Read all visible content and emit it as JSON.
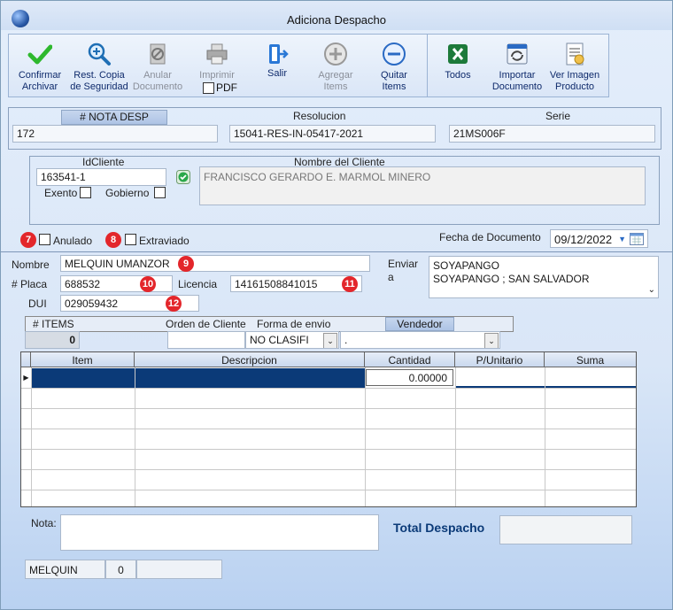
{
  "window": {
    "title": "Adiciona Despacho"
  },
  "toolbar": {
    "confirm": "Confirmar\nArchivar",
    "restore": "Rest. Copia\nde Seguridad",
    "anular": "Anular\nDocumento",
    "imprimir": "Imprimir",
    "pdf": "PDF",
    "salir": "Salir",
    "agregar": "Agregar\nItems",
    "quitar": "Quitar\nItems",
    "todos": "Todos",
    "importar": "Importar\nDocumento",
    "ver_imagen": "Ver Imagen\nProducto"
  },
  "header": {
    "nota_label": "# NOTA DESP",
    "nota_value": "172",
    "resolucion_label": "Resolucion",
    "resolucion_value": "15041-RES-IN-05417-2021",
    "serie_label": "Serie",
    "serie_value": "21MS006F"
  },
  "cliente": {
    "id_label": "IdCliente",
    "id_value": "163541-1",
    "nombre_label": "Nombre del Cliente",
    "nombre_value": "FRANCISCO GERARDO E. MARMOL MINERO",
    "exento": "Exento",
    "gobierno": "Gobierno"
  },
  "flags": {
    "anulado": "Anulado",
    "extraviado": "Extraviado",
    "badge7": "7",
    "badge8": "8"
  },
  "fecha": {
    "label": "Fecha de Documento",
    "value": "09/12/2022"
  },
  "driver": {
    "nombre_label": "Nombre",
    "nombre_value": "MELQUIN UMANZOR",
    "badge9": "9",
    "placa_label": "# Placa",
    "placa_value": "688532",
    "badge10": "10",
    "licencia_label": "Licencia",
    "licencia_value": "14161508841015",
    "badge11": "11",
    "dui_label": "DUI",
    "dui_value": "029059432",
    "badge12": "12"
  },
  "enviar": {
    "label1": "Enviar",
    "label2": "a",
    "line1": "SOYAPANGO",
    "line2": "SOYAPANGO ; SAN SALVADOR"
  },
  "items_bar": {
    "items_label": "# ITEMS",
    "items_value": "0",
    "orden_label": "Orden de Cliente",
    "forma_label": "Forma de envio",
    "forma_value": "NO CLASIFI",
    "vendedor_label": "Vendedor",
    "vendedor_value": "."
  },
  "grid": {
    "columns": [
      "Item",
      "Descripcion",
      "Cantidad",
      "P/Unitario",
      "Suma"
    ],
    "rows": [
      {
        "item": "",
        "descripcion": "",
        "cantidad": "0.00000",
        "punitario": "",
        "suma": ""
      }
    ]
  },
  "footer": {
    "nota_label": "Nota:",
    "total_label": "Total Despacho",
    "user": "MELQUIN",
    "count": "0"
  },
  "colors": {
    "accent": "#0b3a78",
    "badge": "#e3262b"
  }
}
